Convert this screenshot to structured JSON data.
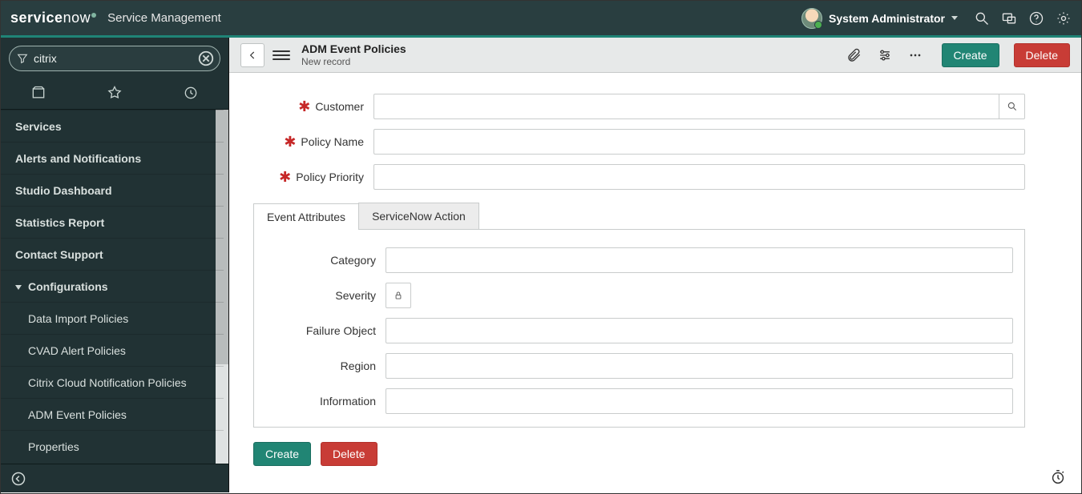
{
  "banner": {
    "logo_service": "service",
    "logo_now": "now",
    "product": "Service Management",
    "user_name": "System Administrator"
  },
  "sidebar": {
    "filter_value": "citrix",
    "items": [
      {
        "label": "Services"
      },
      {
        "label": "Alerts and Notifications"
      },
      {
        "label": "Studio Dashboard"
      },
      {
        "label": "Statistics Report"
      },
      {
        "label": "Contact Support"
      },
      {
        "label": "Configurations",
        "expandable": true
      },
      {
        "label": "Data Import Policies",
        "sub": true
      },
      {
        "label": "CVAD Alert Policies",
        "sub": true
      },
      {
        "label": "Citrix Cloud Notification Policies",
        "sub": true
      },
      {
        "label": "ADM Event Policies",
        "sub": true
      },
      {
        "label": "Properties",
        "sub": true
      }
    ]
  },
  "form": {
    "title": "ADM Event Policies",
    "subtitle": "New record",
    "buttons": {
      "create": "Create",
      "delete": "Delete"
    },
    "fields": {
      "customer": {
        "label": "Customer",
        "value": "",
        "required": true
      },
      "policy_name": {
        "label": "Policy Name",
        "value": "",
        "required": true
      },
      "policy_priority": {
        "label": "Policy Priority",
        "value": "",
        "required": true
      }
    },
    "tabs": {
      "event_attributes": "Event Attributes",
      "servicenow_action": "ServiceNow Action"
    },
    "attr_fields": {
      "category": {
        "label": "Category",
        "value": ""
      },
      "severity": {
        "label": "Severity"
      },
      "failure_object": {
        "label": "Failure Object",
        "value": ""
      },
      "region": {
        "label": "Region",
        "value": ""
      },
      "information": {
        "label": "Information",
        "value": ""
      }
    }
  }
}
